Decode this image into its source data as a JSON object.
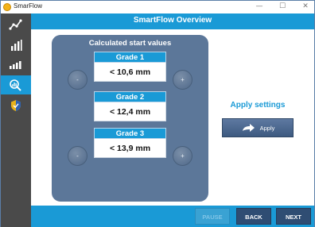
{
  "window": {
    "title": "SmarFlow",
    "minimize": "—",
    "maximize": "☐",
    "close": "✕"
  },
  "header": {
    "title": "SmartFlow Overview"
  },
  "sidebar": {
    "items": [
      {
        "icon": "line-chart-icon",
        "active": false
      },
      {
        "icon": "bar-chart-icon",
        "active": false
      },
      {
        "icon": "signal-bars-icon",
        "active": false
      },
      {
        "icon": "magnifier-chart-icon",
        "active": true
      },
      {
        "icon": "shield-icon",
        "active": false
      }
    ]
  },
  "panel": {
    "title": "Calculated start values",
    "grades": [
      {
        "label": "Grade 1",
        "value": "< 10,6 mm"
      },
      {
        "label": "Grade 2",
        "value": "< 12,4 mm"
      },
      {
        "label": "Grade 3",
        "value": "< 13,9 mm"
      }
    ],
    "decrease_label": "-",
    "increase_label": "+"
  },
  "apply": {
    "heading": "Apply settings",
    "button_label": "Apply"
  },
  "footer": {
    "pause": "PAUSE",
    "back": "BACK",
    "next": "NEXT"
  },
  "colors": {
    "accent": "#1a9ad6",
    "sidebar": "#4a4a4a",
    "panel": "#5c7799",
    "dark_button": "#2f4d73"
  }
}
